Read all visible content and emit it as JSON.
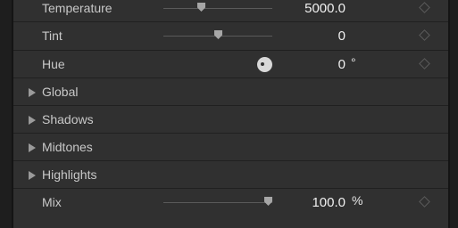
{
  "params": {
    "temperature": {
      "label": "Temperature",
      "value": "5000.0",
      "slider": 0.34
    },
    "tint": {
      "label": "Tint",
      "value": "0",
      "slider": 0.5
    },
    "hue": {
      "label": "Hue",
      "value": "0",
      "unit": "°"
    },
    "mix": {
      "label": "Mix",
      "value": "100.0",
      "unit": "%",
      "slider": 1.0
    }
  },
  "groups": [
    {
      "label": "Global"
    },
    {
      "label": "Shadows"
    },
    {
      "label": "Midtones"
    },
    {
      "label": "Highlights"
    }
  ],
  "icons": {
    "disclosure": "disclosure-triangle-right",
    "keyframe": "keyframe-diamond",
    "hue": "hue-dial"
  }
}
